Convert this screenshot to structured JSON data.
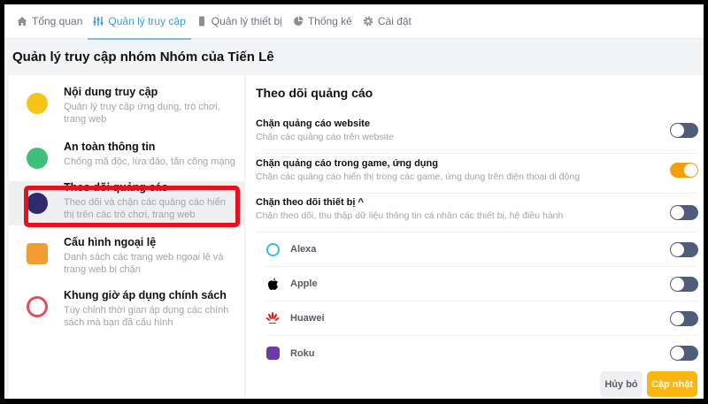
{
  "nav": {
    "tabs": [
      {
        "label": "Tổng quan",
        "icon": "home-icon"
      },
      {
        "label": "Quản lý truy cập",
        "icon": "sliders-icon",
        "active": true
      },
      {
        "label": "Quản lý thiết bị",
        "icon": "phone-icon"
      },
      {
        "label": "Thống kê",
        "icon": "pie-chart-icon"
      },
      {
        "label": "Cài đặt",
        "icon": "gear-icon"
      }
    ]
  },
  "page_title": "Quản lý truy cập nhóm Nhóm của Tiến Lê",
  "menu": [
    {
      "title": "Nội dung truy cập",
      "desc": "Quản lý truy cập ứng dụng, trò chơi, trang web",
      "color": "#f5c518"
    },
    {
      "title": "An toàn thông tin",
      "desc": "Chống mã độc, lừa đảo, tấn công mạng",
      "color": "#3cc07a"
    },
    {
      "title": "Theo dõi quảng cáo",
      "desc": "Theo dõi và chặn các quảng cáo hiển thị trên các trò chơi, trang web",
      "color": "#2f2a6b"
    },
    {
      "title": "Cấu hình ngoại lệ",
      "desc": "Danh sách các trang web ngoại lệ và trang web bị chặn",
      "color": "#f39c34"
    },
    {
      "title": "Khung giờ áp dụng chính sách",
      "desc": "Tùy chỉnh thời gian áp dụng các chính sách mà bạn đã cấu hình",
      "color": "#e74c5c"
    }
  ],
  "section": {
    "title": "Theo dõi quảng cáo",
    "settings": [
      {
        "title": "Chặn quảng cáo website",
        "desc": "Chặn các quảng cáo trên website",
        "on": false
      },
      {
        "title": "Chặn quảng cáo trong game, ứng dụng",
        "desc": "Chặn các quảng cáo hiển thị trong các game, ứng dụng trên điện thoại di động",
        "on": true
      },
      {
        "title": "Chặn theo dõi thiết bị ^",
        "desc": "Chặn theo dõi, thu thập dữ liệu thông tin cá nhân các thiết bị, hệ điều hành",
        "on": false
      }
    ],
    "devices": [
      {
        "name": "Alexa",
        "on": false
      },
      {
        "name": "Apple",
        "on": false
      },
      {
        "name": "Huawei",
        "on": false
      },
      {
        "name": "Roku",
        "on": false
      }
    ]
  },
  "buttons": {
    "cancel": "Hủy bỏ",
    "update": "Cập nhật"
  },
  "colors": {
    "accent": "#3b9be0",
    "toggle_on": "#f59e0b",
    "toggle_off": "#4f5d7a",
    "highlight": "#e8101c",
    "update_btn": "#fbb511"
  }
}
